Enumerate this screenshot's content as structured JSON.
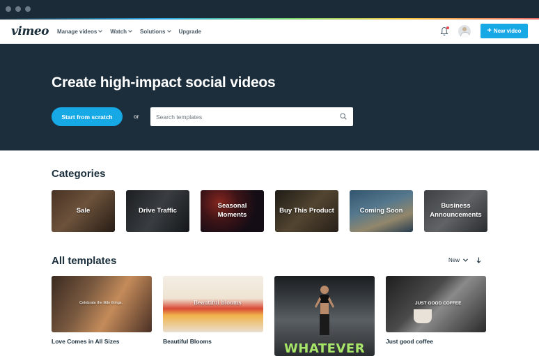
{
  "nav": {
    "logo": "vimeo",
    "items": [
      {
        "label": "Manage videos",
        "caret": true
      },
      {
        "label": "Watch",
        "caret": true
      },
      {
        "label": "Solutions",
        "caret": true
      },
      {
        "label": "Upgrade",
        "caret": false
      }
    ],
    "new_video_label": "New video",
    "new_video_icon": "+"
  },
  "hero": {
    "title": "Create high-impact social videos",
    "start_label": "Start from scratch",
    "or_label": "or",
    "search_placeholder": "Search templates"
  },
  "categories": {
    "title": "Categories",
    "items": [
      "Sale",
      "Drive Traffic",
      "Seasonal Moments",
      "Buy This Product",
      "Coming Soon",
      "Business Announcements"
    ]
  },
  "templates": {
    "title": "All templates",
    "sort_label": "New",
    "items": [
      {
        "name": "Love Comes in All Sizes",
        "overlay": "Celebrate the little things."
      },
      {
        "name": "Beautiful Blooms",
        "overlay": "Beautiful blooms"
      },
      {
        "name": "",
        "overlay": "WHATEVER"
      },
      {
        "name": "Just good coffee",
        "overlay": "JUST GOOD COFFEE"
      }
    ]
  },
  "colors": {
    "accent": "#17a9e6",
    "hero_bg": "#1c2d3b",
    "text": "#1a2e3b"
  }
}
